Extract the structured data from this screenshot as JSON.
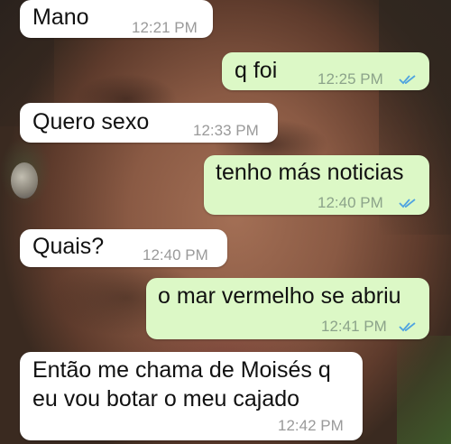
{
  "messages": [
    {
      "direction": "in",
      "text": "Mano",
      "time": "12:21 PM"
    },
    {
      "direction": "out",
      "text": "q foi",
      "time": "12:25 PM",
      "status": "read"
    },
    {
      "direction": "in",
      "text": "Quero sexo",
      "time": "12:33 PM"
    },
    {
      "direction": "out",
      "text": "tenho más noticias",
      "time": "12:40 PM",
      "status": "read"
    },
    {
      "direction": "in",
      "text": "Quais?",
      "time": "12:40 PM"
    },
    {
      "direction": "out",
      "text": "o mar vermelho se abriu",
      "time": "12:41 PM",
      "status": "read"
    },
    {
      "direction": "in",
      "text": "Então me chama de Moisés q\neu vou botar o meu cajado",
      "time": "12:42 PM"
    }
  ],
  "colors": {
    "incoming_bubble": "#ffffff",
    "outgoing_bubble": "#dcf8c6",
    "read_ticks": "#4fa3e0"
  },
  "icons": {
    "read_receipt": "double-check-icon"
  }
}
